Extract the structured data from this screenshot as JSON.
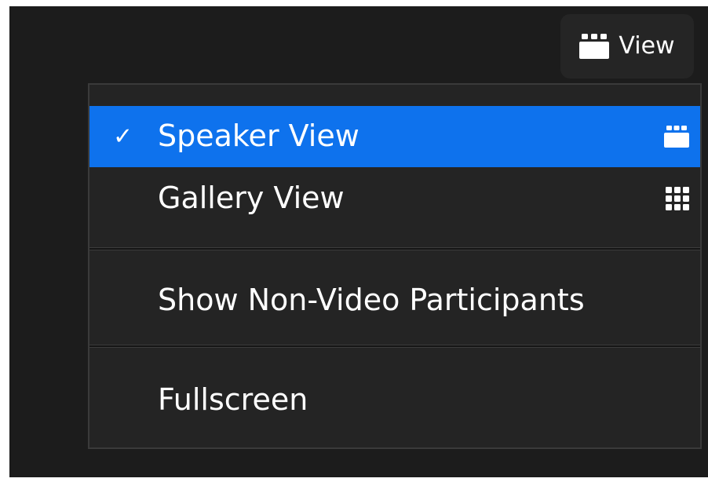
{
  "colors": {
    "window_background": "#1c1c1c",
    "menu_background": "#242424",
    "selected_background": "#0e72ed",
    "text": "#ffffff"
  },
  "header": {
    "view_button": {
      "label": "View",
      "icon": "speaker-view-icon"
    }
  },
  "menu": {
    "items": [
      {
        "label": "Speaker View",
        "checked": true,
        "selected": true,
        "icon": "speaker-view-icon",
        "check_glyph": "✓"
      },
      {
        "label": "Gallery View",
        "checked": false,
        "selected": false,
        "icon": "gallery-view-icon"
      },
      {
        "label": "Show Non-Video Participants",
        "checked": false,
        "selected": false
      },
      {
        "label": "Fullscreen",
        "checked": false,
        "selected": false
      }
    ]
  }
}
